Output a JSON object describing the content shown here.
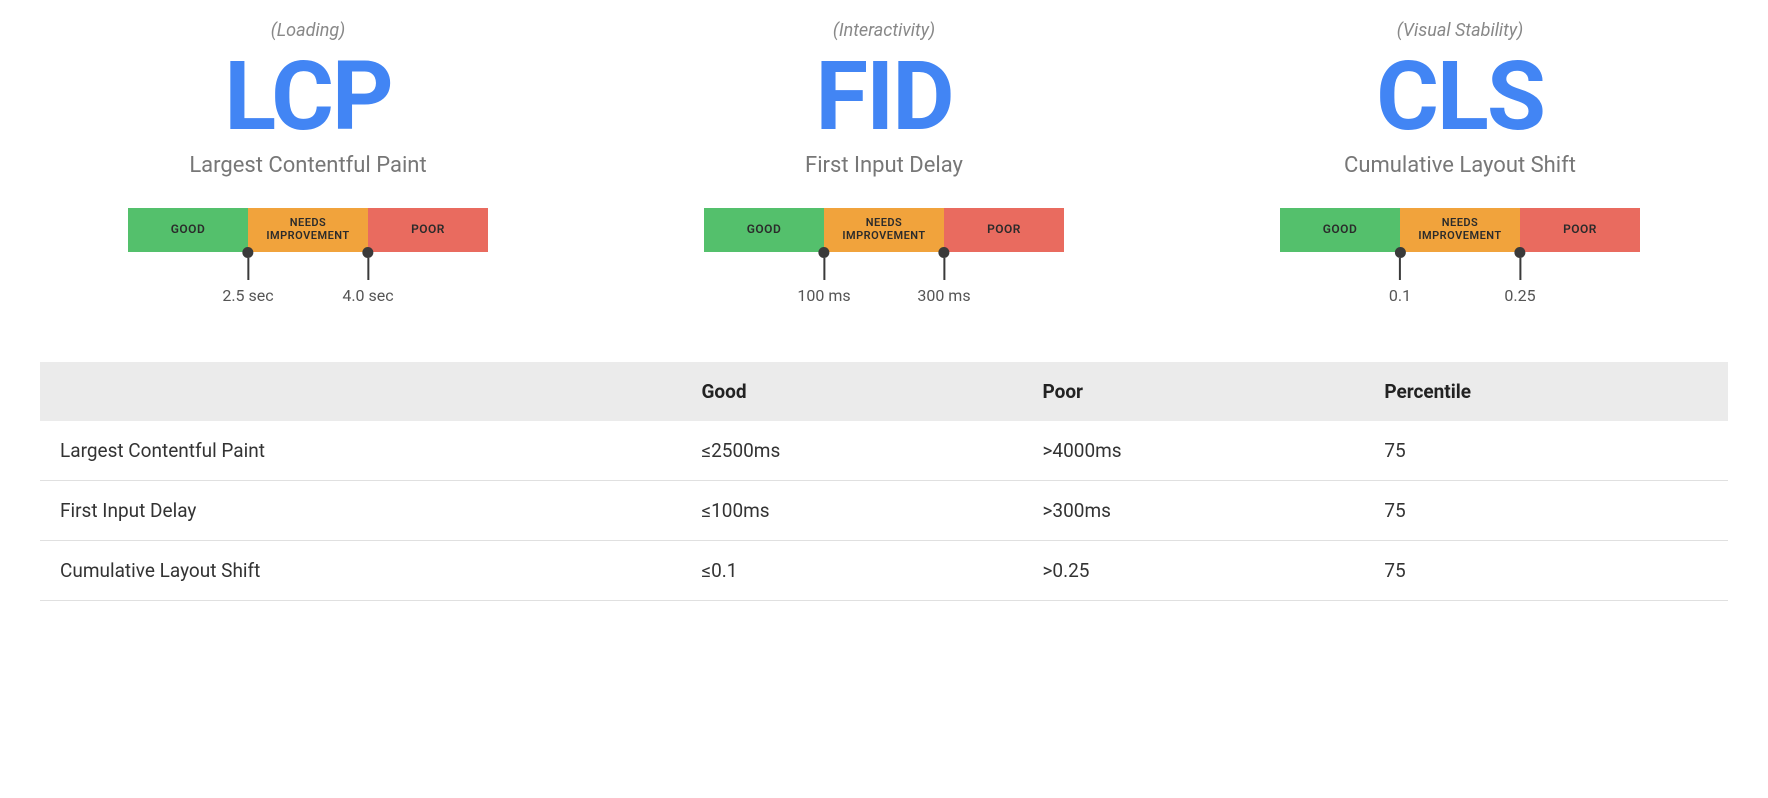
{
  "metrics": [
    {
      "category": "(Loading)",
      "abbr": "LCP",
      "fullname": "Largest Contentful Paint",
      "segments": {
        "good": "GOOD",
        "needs": "NEEDS IMPROVEMENT",
        "poor": "POOR"
      },
      "thresholds": {
        "t1": "2.5 sec",
        "t2": "4.0 sec"
      }
    },
    {
      "category": "(Interactivity)",
      "abbr": "FID",
      "fullname": "First Input Delay",
      "segments": {
        "good": "GOOD",
        "needs": "NEEDS IMPROVEMENT",
        "poor": "POOR"
      },
      "thresholds": {
        "t1": "100 ms",
        "t2": "300 ms"
      }
    },
    {
      "category": "(Visual Stability)",
      "abbr": "CLS",
      "fullname": "Cumulative Layout Shift",
      "segments": {
        "good": "GOOD",
        "needs": "NEEDS IMPROVEMENT",
        "poor": "POOR"
      },
      "thresholds": {
        "t1": "0.1",
        "t2": "0.25"
      }
    }
  ],
  "table": {
    "headers": {
      "metric": "",
      "good": "Good",
      "poor": "Poor",
      "percentile": "Percentile"
    },
    "rows": [
      {
        "metric": "Largest Contentful Paint",
        "good": "≤2500ms",
        "poor": ">4000ms",
        "percentile": "75"
      },
      {
        "metric": "First Input Delay",
        "good": "≤100ms",
        "poor": ">300ms",
        "percentile": "75"
      },
      {
        "metric": "Cumulative Layout Shift",
        "good": "≤0.1",
        "poor": ">0.25",
        "percentile": "75"
      }
    ]
  }
}
